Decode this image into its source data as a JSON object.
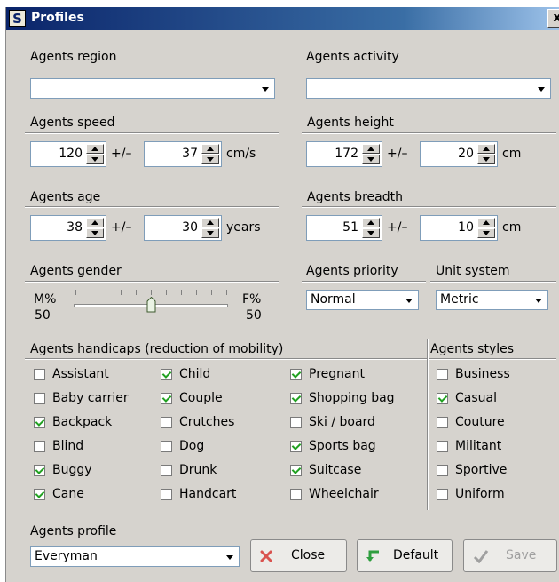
{
  "window": {
    "title": "Profiles",
    "close_label": "x"
  },
  "region": {
    "label": "Agents region",
    "value": ""
  },
  "activity": {
    "label": "Agents activity",
    "value": ""
  },
  "speed": {
    "label": "Agents speed",
    "value": "120",
    "pm": "+/–",
    "deviation": "37",
    "unit": "cm/s"
  },
  "height": {
    "label": "Agents height",
    "value": "172",
    "pm": "+/–",
    "deviation": "20",
    "unit": "cm"
  },
  "age": {
    "label": "Agents age",
    "value": "38",
    "pm": "+/–",
    "deviation": "30",
    "unit": "years"
  },
  "breadth": {
    "label": "Agents breadth",
    "value": "51",
    "pm": "+/–",
    "deviation": "10",
    "unit": "cm"
  },
  "gender": {
    "label": "Agents gender",
    "m_label": "M%",
    "f_label": "F%",
    "m_value": "50",
    "f_value": "50",
    "ratio": 0.5
  },
  "priority": {
    "label": "Agents priority",
    "value": "Normal"
  },
  "units": {
    "label": "Unit system",
    "value": "Metric"
  },
  "handicaps": {
    "label": "Agents handicaps  (reduction of mobility)",
    "items": [
      {
        "label": "Assistant",
        "checked": false
      },
      {
        "label": "Baby carrier",
        "checked": false
      },
      {
        "label": "Backpack",
        "checked": true
      },
      {
        "label": "Blind",
        "checked": false
      },
      {
        "label": "Buggy",
        "checked": true
      },
      {
        "label": "Cane",
        "checked": true
      },
      {
        "label": "Child",
        "checked": true
      },
      {
        "label": "Couple",
        "checked": true
      },
      {
        "label": "Crutches",
        "checked": false
      },
      {
        "label": "Dog",
        "checked": false
      },
      {
        "label": "Drunk",
        "checked": false
      },
      {
        "label": "Handcart",
        "checked": false
      },
      {
        "label": "Pregnant",
        "checked": true
      },
      {
        "label": "Shopping bag",
        "checked": true
      },
      {
        "label": "Ski / board",
        "checked": false
      },
      {
        "label": "Sports bag",
        "checked": true
      },
      {
        "label": "Suitcase",
        "checked": true
      },
      {
        "label": "Wheelchair",
        "checked": false
      }
    ]
  },
  "styles": {
    "label": "Agents styles",
    "items": [
      {
        "label": "Business",
        "checked": false
      },
      {
        "label": "Casual",
        "checked": true
      },
      {
        "label": "Couture",
        "checked": false
      },
      {
        "label": "Militant",
        "checked": false
      },
      {
        "label": "Sportive",
        "checked": false
      },
      {
        "label": "Uniform",
        "checked": false
      }
    ]
  },
  "profile": {
    "label": "Agents profile",
    "value": "Everyman"
  },
  "buttons": {
    "close": "Close",
    "default": "Default",
    "save": "Save"
  },
  "colors": {
    "title_bar": "#0a246a",
    "close_icon": "#d9534f",
    "default_icon": "#2e9e3e",
    "check": "#21a121"
  }
}
